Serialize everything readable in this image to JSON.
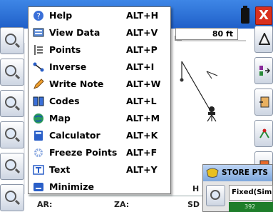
{
  "header": {
    "scale_value": "80 ft",
    "close_label": "X"
  },
  "menu": {
    "items": [
      {
        "label": "Help",
        "shortcut": "ALT+H",
        "icon": "help-icon"
      },
      {
        "label": "View Data",
        "shortcut": "ALT+V",
        "icon": "view-data-icon"
      },
      {
        "label": "Points",
        "shortcut": "ALT+P",
        "icon": "points-icon"
      },
      {
        "label": "Inverse",
        "shortcut": "ALT+I",
        "icon": "inverse-icon"
      },
      {
        "label": "Write Note",
        "shortcut": "ALT+W",
        "icon": "pencil-icon"
      },
      {
        "label": "Codes",
        "shortcut": "ALT+L",
        "icon": "codes-icon"
      },
      {
        "label": "Map",
        "shortcut": "ALT+M",
        "icon": "globe-icon"
      },
      {
        "label": "Calculator",
        "shortcut": "ALT+K",
        "icon": "calculator-icon"
      },
      {
        "label": "Freeze Points",
        "shortcut": "ALT+F",
        "icon": "freeze-icon"
      },
      {
        "label": "Text",
        "shortcut": "ALT+Y",
        "icon": "text-icon"
      },
      {
        "label": "Minimize",
        "shortcut": "",
        "icon": "minimize-icon"
      }
    ]
  },
  "status": {
    "ar_label": "AR:",
    "za_label": "ZA:",
    "sd_label": "SD",
    "h_label": "H"
  },
  "store_panel": {
    "title": "STORE PTS",
    "field_value": "Fixed(Sim",
    "code_value": "392"
  },
  "colors": {
    "titlebar": "#2a6fd6",
    "close": "#d9301e",
    "store_green": "#1e7d2a"
  }
}
